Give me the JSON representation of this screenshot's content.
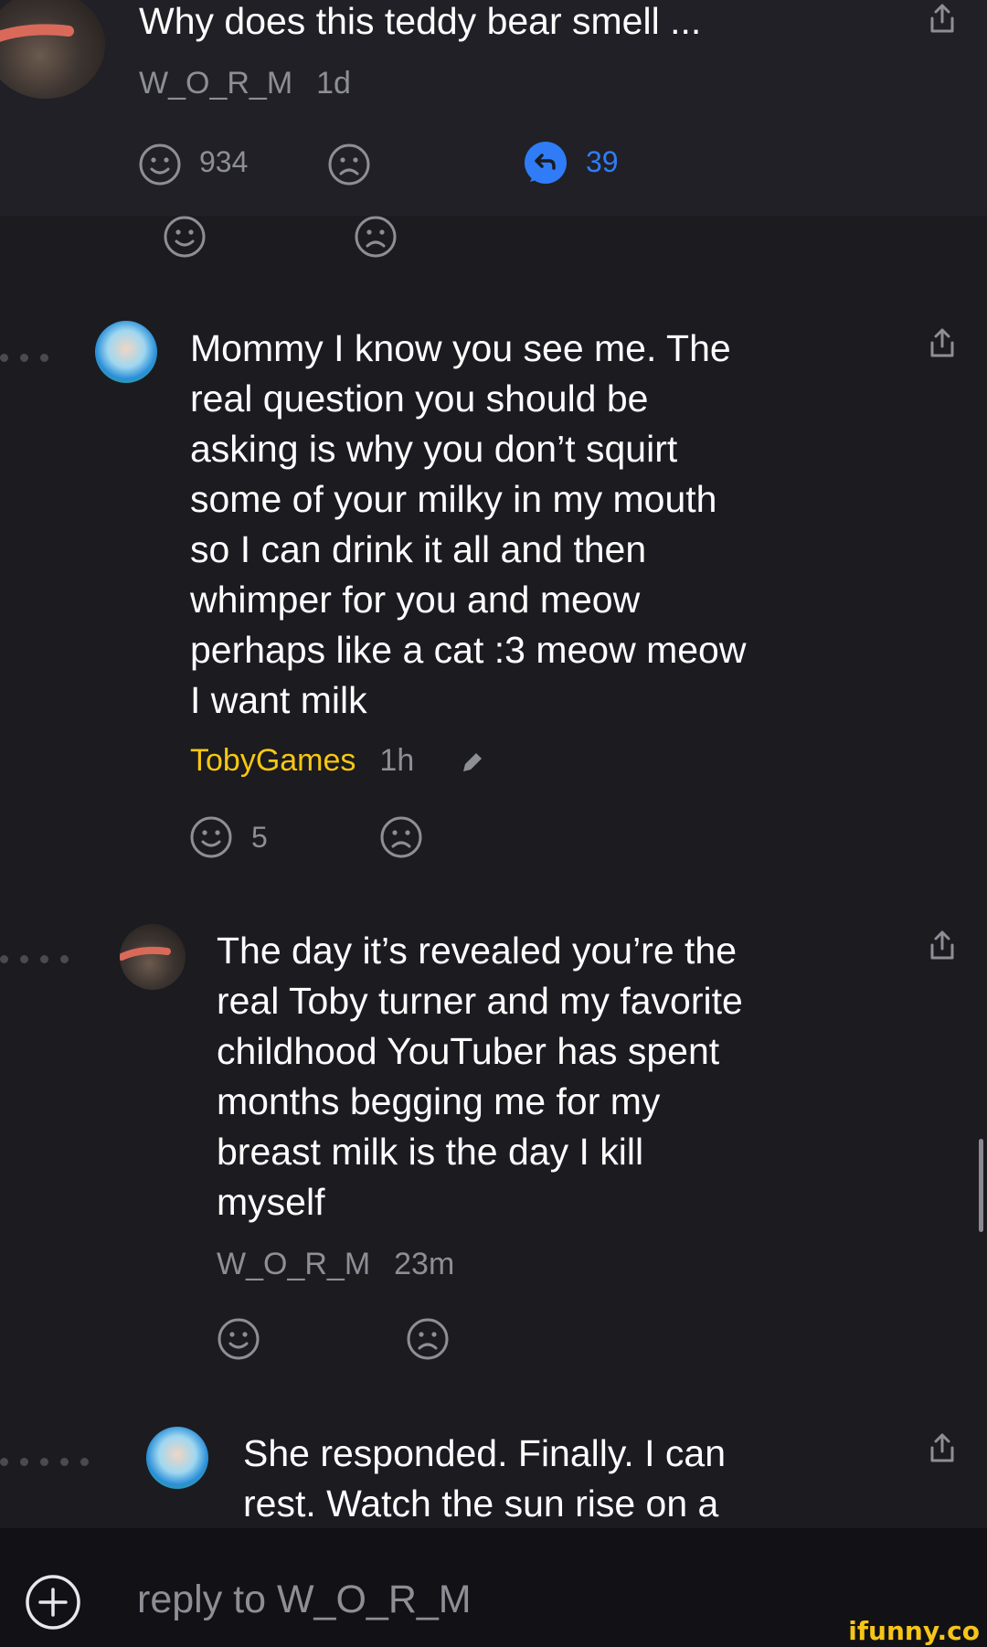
{
  "post": {
    "title": "Why does this teddy bear smell ...",
    "author": "W_O_R_M",
    "time": "1d",
    "smile_count": "934",
    "reply_count": "39"
  },
  "comments": [
    {
      "author": "TobyGames",
      "time": "1h",
      "text": "Mommy I know you see me. The\nreal question you should be\nasking is why you don’t squirt\nsome of your milky in my mouth\nso I can drink it all and then\nwhimper for you and meow\nperhaps like a cat :3 meow meow\nI want milk",
      "smile_count": "5"
    },
    {
      "author": "W_O_R_M",
      "time": "23m",
      "text": "The day it’s revealed you’re the\nreal Toby turner and my favorite\nchildhood YouTuber has spent\nmonths begging me for my\nbreast milk is the day I kill\nmyself"
    },
    {
      "text": "She responded. Finally. I can\nrest. Watch the sun rise on a"
    }
  ],
  "reply": {
    "placeholder": "reply to W_O_R_M"
  },
  "watermark": "ifunny.co",
  "colors": {
    "accent_blue": "#2f7cf6",
    "author_yellow": "#f7c711",
    "background": "#1b1b20"
  },
  "icons": [
    "smile-icon",
    "frown-icon",
    "reply-bubble-icon",
    "share-icon",
    "edit-pencil-icon",
    "add-circle-icon"
  ]
}
